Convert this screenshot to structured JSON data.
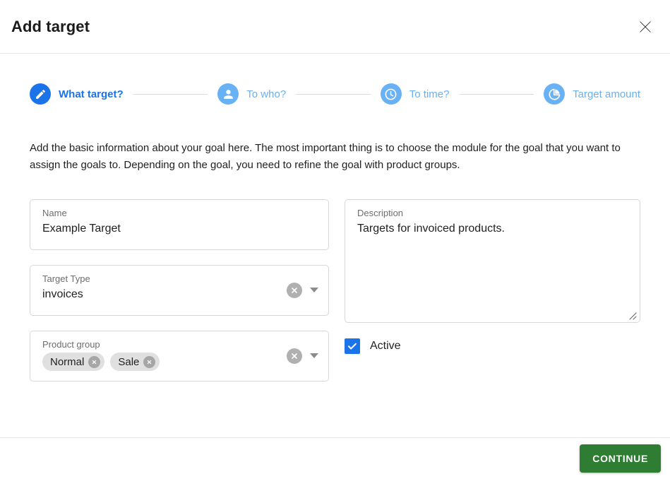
{
  "dialog": {
    "title": "Add target",
    "close_icon": "close-icon"
  },
  "stepper": {
    "steps": [
      {
        "label": "What target?",
        "icon": "pencil-icon",
        "state": "active"
      },
      {
        "label": "To who?",
        "icon": "person-icon",
        "state": "inactive"
      },
      {
        "label": "To time?",
        "icon": "clock-icon",
        "state": "inactive"
      },
      {
        "label": "Target amount",
        "icon": "pie-chart-icon",
        "state": "inactive"
      }
    ]
  },
  "intro": {
    "text": "Add the basic information about your goal here. The most important thing is to choose the module for the goal that you want to assign the goals to. Depending on the goal, you need to refine the goal with product groups."
  },
  "form": {
    "name": {
      "label": "Name",
      "value": "Example Target",
      "placeholder": "Name"
    },
    "target_type": {
      "label": "Target Type",
      "value": "invoices",
      "clear_icon": "clear-circle-icon",
      "dropdown_icon": "chevron-down-icon"
    },
    "product_group": {
      "label": "Product group",
      "chips": [
        {
          "label": "Normal",
          "remove_icon": "chip-remove-icon"
        },
        {
          "label": "Sale",
          "remove_icon": "chip-remove-icon"
        }
      ],
      "clear_icon": "clear-circle-icon",
      "dropdown_icon": "chevron-down-icon"
    },
    "description": {
      "label": "Description",
      "value": "Targets for invoiced products.",
      "placeholder": "Description",
      "resize_icon": "resize-handle-icon"
    },
    "active": {
      "label": "Active",
      "checked": true,
      "check_icon": "checkmark-icon"
    }
  },
  "footer": {
    "continue_label": "CONTINUE"
  },
  "colors": {
    "accent_blue": "#1a73e8",
    "step_inactive_blue": "#69b1f5",
    "continue_green": "#2f7d32",
    "chip_gray": "#e0e0e0",
    "border_gray": "#d7d7d7"
  }
}
